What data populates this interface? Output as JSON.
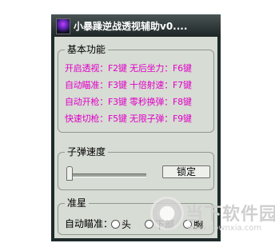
{
  "window": {
    "title": "小暴躁逆战透视辅助v0...."
  },
  "features_group": {
    "label": "基本功能",
    "rows": [
      "开启透视：F2键 无后坐力：F6键",
      "自动瞄准：F3键 十倍射速：F7键",
      "自动开枪：F3键 零秒换弹：F8键",
      "快速切枪：F5键 无限子弹：F9键"
    ]
  },
  "speed_group": {
    "label": "子弹速度",
    "lock_button": "锁定"
  },
  "aim_group": {
    "label": "准星",
    "auto_aim_label": "自动瞄准：",
    "options": [
      "头",
      "下部",
      "胸"
    ]
  },
  "watermark": {
    "text": "当下软件园",
    "url": "www.downxia.com"
  },
  "colors": {
    "title_bar": "#1e2626",
    "client_bg": "#d7dcd4",
    "feature_text": "#e000c8"
  }
}
